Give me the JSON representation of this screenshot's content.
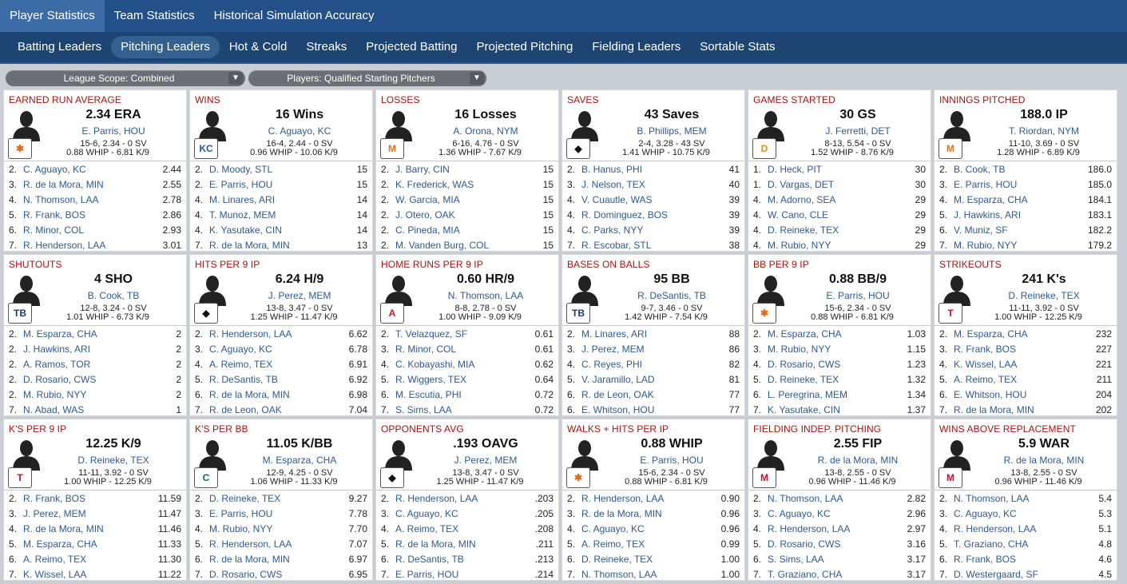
{
  "top_tabs": [
    {
      "label": "Player Statistics",
      "active": true
    },
    {
      "label": "Team Statistics",
      "active": false
    },
    {
      "label": "Historical Simulation Accuracy",
      "active": false
    }
  ],
  "sub_tabs": [
    {
      "label": "Batting Leaders",
      "active": false
    },
    {
      "label": "Pitching Leaders",
      "active": true
    },
    {
      "label": "Hot & Cold",
      "active": false
    },
    {
      "label": "Streaks",
      "active": false
    },
    {
      "label": "Projected Batting",
      "active": false
    },
    {
      "label": "Projected Pitching",
      "active": false
    },
    {
      "label": "Fielding Leaders",
      "active": false
    },
    {
      "label": "Sortable Stats",
      "active": false
    }
  ],
  "filters": {
    "league_scope": "League Scope: Combined",
    "players": "Players: Qualified Starting Pitchers"
  },
  "cards": [
    {
      "title": "EARNED RUN AVERAGE",
      "logo": "HOU",
      "leader": {
        "value": "2.34 ERA",
        "name": "E. Parris, HOU",
        "line1": "15-6, 2.34 - 0 SV",
        "line2": "0.88 WHIP - 6.81 K/9"
      },
      "rows": [
        {
          "rank": "2.",
          "name": "C. Aguayo, KC",
          "value": "2.44"
        },
        {
          "rank": "3.",
          "name": "R. de la Mora, MIN",
          "value": "2.55"
        },
        {
          "rank": "4.",
          "name": "N. Thomson, LAA",
          "value": "2.78"
        },
        {
          "rank": "5.",
          "name": "R. Frank, BOS",
          "value": "2.86"
        },
        {
          "rank": "6.",
          "name": "R. Minor, COL",
          "value": "2.93"
        },
        {
          "rank": "7.",
          "name": "R. Henderson, LAA",
          "value": "3.01"
        }
      ]
    },
    {
      "title": "WINS",
      "logo": "KC",
      "leader": {
        "value": "16 Wins",
        "name": "C. Aguayo, KC",
        "line1": "16-4, 2.44 - 0 SV",
        "line2": "0.96 WHIP - 10.06 K/9"
      },
      "rows": [
        {
          "rank": "2.",
          "name": "D. Moody, STL",
          "value": "15"
        },
        {
          "rank": "2.",
          "name": "E. Parris, HOU",
          "value": "15"
        },
        {
          "rank": "4.",
          "name": "M. Linares, ARI",
          "value": "14"
        },
        {
          "rank": "4.",
          "name": "T. Munoz, MEM",
          "value": "14"
        },
        {
          "rank": "4.",
          "name": "K. Yasutake, CIN",
          "value": "14"
        },
        {
          "rank": "7.",
          "name": "R. de la Mora, MIN",
          "value": "13"
        }
      ]
    },
    {
      "title": "LOSSES",
      "logo": "NYM",
      "leader": {
        "value": "16 Losses",
        "name": "A. Orona, NYM",
        "line1": "6-16, 4.76 - 0 SV",
        "line2": "1.36 WHIP - 7.67 K/9"
      },
      "rows": [
        {
          "rank": "2.",
          "name": "J. Barry, CIN",
          "value": "15"
        },
        {
          "rank": "2.",
          "name": "K. Frederick, WAS",
          "value": "15"
        },
        {
          "rank": "2.",
          "name": "W. Garcia, MIA",
          "value": "15"
        },
        {
          "rank": "2.",
          "name": "J. Otero, OAK",
          "value": "15"
        },
        {
          "rank": "2.",
          "name": "C. Pineda, MIA",
          "value": "15"
        },
        {
          "rank": "2.",
          "name": "M. Vanden Burg, COL",
          "value": "15"
        }
      ]
    },
    {
      "title": "SAVES",
      "logo": "MEM",
      "leader": {
        "value": "43 Saves",
        "name": "B. Phillips, MEM",
        "line1": "2-4, 3.28 - 43 SV",
        "line2": "1.41 WHIP - 10.75 K/9"
      },
      "rows": [
        {
          "rank": "2.",
          "name": "B. Hanus, PHI",
          "value": "41"
        },
        {
          "rank": "3.",
          "name": "J. Nelson, TEX",
          "value": "40"
        },
        {
          "rank": "4.",
          "name": "V. Cuautle, WAS",
          "value": "39"
        },
        {
          "rank": "4.",
          "name": "R. Dominguez, BOS",
          "value": "39"
        },
        {
          "rank": "4.",
          "name": "C. Parks, NYY",
          "value": "39"
        },
        {
          "rank": "7.",
          "name": "R. Escobar, STL",
          "value": "38"
        }
      ]
    },
    {
      "title": "GAMES STARTED",
      "logo": "DET",
      "leader": {
        "value": "30 GS",
        "name": "J. Ferretti, DET",
        "line1": "8-13, 5.54 - 0 SV",
        "line2": "1.52 WHIP - 8.76 K/9"
      },
      "rows": [
        {
          "rank": "1.",
          "name": "D. Heck, PIT",
          "value": "30"
        },
        {
          "rank": "1.",
          "name": "D. Vargas, DET",
          "value": "30"
        },
        {
          "rank": "4.",
          "name": "M. Adorno, SEA",
          "value": "29"
        },
        {
          "rank": "4.",
          "name": "W. Cano, CLE",
          "value": "29"
        },
        {
          "rank": "4.",
          "name": "D. Reineke, TEX",
          "value": "29"
        },
        {
          "rank": "4.",
          "name": "M. Rubio, NYY",
          "value": "29"
        }
      ]
    },
    {
      "title": "INNINGS PITCHED",
      "logo": "NYM",
      "leader": {
        "value": "188.0 IP",
        "name": "T. Riordan, NYM",
        "line1": "11-10, 3.69 - 0 SV",
        "line2": "1.28 WHIP - 6.89 K/9"
      },
      "rows": [
        {
          "rank": "2.",
          "name": "B. Cook, TB",
          "value": "186.0"
        },
        {
          "rank": "3.",
          "name": "E. Parris, HOU",
          "value": "185.0"
        },
        {
          "rank": "4.",
          "name": "M. Esparza, CHA",
          "value": "184.1"
        },
        {
          "rank": "5.",
          "name": "J. Hawkins, ARI",
          "value": "183.1"
        },
        {
          "rank": "6.",
          "name": "V. Muniz, SF",
          "value": "182.2"
        },
        {
          "rank": "7.",
          "name": "M. Rubio, NYY",
          "value": "179.2"
        }
      ]
    },
    {
      "title": "SHUTOUTS",
      "logo": "TB",
      "leader": {
        "value": "4 SHO",
        "name": "B. Cook, TB",
        "line1": "12-8, 3.24 - 0 SV",
        "line2": "1.01 WHIP - 6.73 K/9"
      },
      "rows": [
        {
          "rank": "2.",
          "name": "M. Esparza, CHA",
          "value": "2"
        },
        {
          "rank": "2.",
          "name": "J. Hawkins, ARI",
          "value": "2"
        },
        {
          "rank": "2.",
          "name": "A. Ramos, TOR",
          "value": "2"
        },
        {
          "rank": "2.",
          "name": "D. Rosario, CWS",
          "value": "2"
        },
        {
          "rank": "2.",
          "name": "M. Rubio, NYY",
          "value": "2"
        },
        {
          "rank": "7.",
          "name": "N. Abad, WAS",
          "value": "1"
        }
      ]
    },
    {
      "title": "HITS PER 9 IP",
      "logo": "MEM",
      "leader": {
        "value": "6.24 H/9",
        "name": "J. Perez, MEM",
        "line1": "13-8, 3.47 - 0 SV",
        "line2": "1.25 WHIP - 11.47 K/9"
      },
      "rows": [
        {
          "rank": "2.",
          "name": "R. Henderson, LAA",
          "value": "6.62"
        },
        {
          "rank": "3.",
          "name": "C. Aguayo, KC",
          "value": "6.78"
        },
        {
          "rank": "4.",
          "name": "A. Reimo, TEX",
          "value": "6.91"
        },
        {
          "rank": "5.",
          "name": "R. DeSantis, TB",
          "value": "6.92"
        },
        {
          "rank": "6.",
          "name": "R. de la Mora, MIN",
          "value": "6.98"
        },
        {
          "rank": "7.",
          "name": "R. de Leon, OAK",
          "value": "7.04"
        }
      ]
    },
    {
      "title": "HOME RUNS PER 9 IP",
      "logo": "LAA",
      "leader": {
        "value": "0.60 HR/9",
        "name": "N. Thomson, LAA",
        "line1": "8-8, 2.78 - 0 SV",
        "line2": "1.00 WHIP - 9.09 K/9"
      },
      "rows": [
        {
          "rank": "2.",
          "name": "T. Velazquez, SF",
          "value": "0.61"
        },
        {
          "rank": "3.",
          "name": "R. Minor, COL",
          "value": "0.61"
        },
        {
          "rank": "4.",
          "name": "C. Kobayashi, MIA",
          "value": "0.62"
        },
        {
          "rank": "5.",
          "name": "R. Wiggers, TEX",
          "value": "0.64"
        },
        {
          "rank": "6.",
          "name": "M. Escutia, PHI",
          "value": "0.72"
        },
        {
          "rank": "7.",
          "name": "S. Sims, LAA",
          "value": "0.72"
        }
      ]
    },
    {
      "title": "BASES ON BALLS",
      "logo": "TB",
      "leader": {
        "value": "95 BB",
        "name": "R. DeSantis, TB",
        "line1": "9-7, 3.46 - 0 SV",
        "line2": "1.42 WHIP - 7.54 K/9"
      },
      "rows": [
        {
          "rank": "2.",
          "name": "M. Linares, ARI",
          "value": "88"
        },
        {
          "rank": "3.",
          "name": "J. Perez, MEM",
          "value": "86"
        },
        {
          "rank": "4.",
          "name": "C. Reyes, PHI",
          "value": "82"
        },
        {
          "rank": "5.",
          "name": "V. Jaramillo, LAD",
          "value": "81"
        },
        {
          "rank": "6.",
          "name": "R. de Leon, OAK",
          "value": "77"
        },
        {
          "rank": "6.",
          "name": "E. Whitson, HOU",
          "value": "77"
        }
      ]
    },
    {
      "title": "BB PER 9 IP",
      "logo": "HOU",
      "leader": {
        "value": "0.88 BB/9",
        "name": "E. Parris, HOU",
        "line1": "15-6, 2.34 - 0 SV",
        "line2": "0.88 WHIP - 6.81 K/9"
      },
      "rows": [
        {
          "rank": "2.",
          "name": "M. Esparza, CHA",
          "value": "1.03"
        },
        {
          "rank": "3.",
          "name": "M. Rubio, NYY",
          "value": "1.15"
        },
        {
          "rank": "4.",
          "name": "D. Rosario, CWS",
          "value": "1.23"
        },
        {
          "rank": "5.",
          "name": "D. Reineke, TEX",
          "value": "1.32"
        },
        {
          "rank": "6.",
          "name": "L. Peregrina, MEM",
          "value": "1.34"
        },
        {
          "rank": "7.",
          "name": "K. Yasutake, CIN",
          "value": "1.37"
        }
      ]
    },
    {
      "title": "STRIKEOUTS",
      "logo": "TEX",
      "leader": {
        "value": "241 K's",
        "name": "D. Reineke, TEX",
        "line1": "11-11, 3.92 - 0 SV",
        "line2": "1.00 WHIP - 12.25 K/9"
      },
      "rows": [
        {
          "rank": "2.",
          "name": "M. Esparza, CHA",
          "value": "232"
        },
        {
          "rank": "3.",
          "name": "R. Frank, BOS",
          "value": "227"
        },
        {
          "rank": "4.",
          "name": "K. Wissel, LAA",
          "value": "221"
        },
        {
          "rank": "5.",
          "name": "A. Reimo, TEX",
          "value": "211"
        },
        {
          "rank": "6.",
          "name": "E. Whitson, HOU",
          "value": "204"
        },
        {
          "rank": "7.",
          "name": "R. de la Mora, MIN",
          "value": "202"
        }
      ]
    },
    {
      "title": "K'S PER 9 IP",
      "logo": "TEX",
      "leader": {
        "value": "12.25 K/9",
        "name": "D. Reineke, TEX",
        "line1": "11-11, 3.92 - 0 SV",
        "line2": "1.00 WHIP - 12.25 K/9"
      },
      "rows": [
        {
          "rank": "2.",
          "name": "R. Frank, BOS",
          "value": "11.59"
        },
        {
          "rank": "3.",
          "name": "J. Perez, MEM",
          "value": "11.47"
        },
        {
          "rank": "4.",
          "name": "R. de la Mora, MIN",
          "value": "11.46"
        },
        {
          "rank": "5.",
          "name": "M. Esparza, CHA",
          "value": "11.33"
        },
        {
          "rank": "6.",
          "name": "A. Reimo, TEX",
          "value": "11.30"
        },
        {
          "rank": "7.",
          "name": "K. Wissel, LAA",
          "value": "11.22"
        }
      ]
    },
    {
      "title": "K'S PER BB",
      "logo": "CHA",
      "leader": {
        "value": "11.05 K/BB",
        "name": "M. Esparza, CHA",
        "line1": "12-9, 4.25 - 0 SV",
        "line2": "1.06 WHIP - 11.33 K/9"
      },
      "rows": [
        {
          "rank": "2.",
          "name": "D. Reineke, TEX",
          "value": "9.27"
        },
        {
          "rank": "3.",
          "name": "E. Parris, HOU",
          "value": "7.78"
        },
        {
          "rank": "4.",
          "name": "M. Rubio, NYY",
          "value": "7.70"
        },
        {
          "rank": "5.",
          "name": "R. Henderson, LAA",
          "value": "7.07"
        },
        {
          "rank": "6.",
          "name": "R. de la Mora, MIN",
          "value": "6.97"
        },
        {
          "rank": "7.",
          "name": "D. Rosario, CWS",
          "value": "6.95"
        }
      ]
    },
    {
      "title": "OPPONENTS AVG",
      "logo": "MEM",
      "leader": {
        "value": ".193 OAVG",
        "name": "J. Perez, MEM",
        "line1": "13-8, 3.47 - 0 SV",
        "line2": "1.25 WHIP - 11.47 K/9"
      },
      "rows": [
        {
          "rank": "2.",
          "name": "R. Henderson, LAA",
          "value": ".203"
        },
        {
          "rank": "3.",
          "name": "C. Aguayo, KC",
          "value": ".205"
        },
        {
          "rank": "4.",
          "name": "A. Reimo, TEX",
          "value": ".208"
        },
        {
          "rank": "5.",
          "name": "R. de la Mora, MIN",
          "value": ".211"
        },
        {
          "rank": "6.",
          "name": "R. DeSantis, TB",
          "value": ".213"
        },
        {
          "rank": "7.",
          "name": "E. Parris, HOU",
          "value": ".214"
        }
      ]
    },
    {
      "title": "WALKS + HITS PER IP",
      "logo": "HOU",
      "leader": {
        "value": "0.88 WHIP",
        "name": "E. Parris, HOU",
        "line1": "15-6, 2.34 - 0 SV",
        "line2": "0.88 WHIP - 6.81 K/9"
      },
      "rows": [
        {
          "rank": "2.",
          "name": "R. Henderson, LAA",
          "value": "0.90"
        },
        {
          "rank": "3.",
          "name": "R. de la Mora, MIN",
          "value": "0.96"
        },
        {
          "rank": "4.",
          "name": "C. Aguayo, KC",
          "value": "0.96"
        },
        {
          "rank": "5.",
          "name": "A. Reimo, TEX",
          "value": "0.99"
        },
        {
          "rank": "6.",
          "name": "D. Reineke, TEX",
          "value": "1.00"
        },
        {
          "rank": "7.",
          "name": "N. Thomson, LAA",
          "value": "1.00"
        }
      ]
    },
    {
      "title": "FIELDING INDEP. PITCHING",
      "logo": "MIN",
      "leader": {
        "value": "2.55 FIP",
        "name": "R. de la Mora, MIN",
        "line1": "13-8, 2.55 - 0 SV",
        "line2": "0.96 WHIP - 11.46 K/9"
      },
      "rows": [
        {
          "rank": "2.",
          "name": "N. Thomson, LAA",
          "value": "2.82"
        },
        {
          "rank": "3.",
          "name": "C. Aguayo, KC",
          "value": "2.96"
        },
        {
          "rank": "4.",
          "name": "R. Henderson, LAA",
          "value": "2.97"
        },
        {
          "rank": "5.",
          "name": "D. Rosario, CWS",
          "value": "3.16"
        },
        {
          "rank": "6.",
          "name": "S. Sims, LAA",
          "value": "3.17"
        },
        {
          "rank": "7.",
          "name": "T. Graziano, CHA",
          "value": "3.17"
        }
      ]
    },
    {
      "title": "WINS ABOVE REPLACEMENT",
      "logo": "MIN",
      "leader": {
        "value": "5.9 WAR",
        "name": "R. de la Mora, MIN",
        "line1": "13-8, 2.55 - 0 SV",
        "line2": "0.96 WHIP - 11.46 K/9"
      },
      "rows": [
        {
          "rank": "2.",
          "name": "N. Thomson, LAA",
          "value": "5.4"
        },
        {
          "rank": "3.",
          "name": "C. Aguayo, KC",
          "value": "5.3"
        },
        {
          "rank": "4.",
          "name": "R. Henderson, LAA",
          "value": "5.1"
        },
        {
          "rank": "5.",
          "name": "T. Graziano, CHA",
          "value": "4.8"
        },
        {
          "rank": "6.",
          "name": "R. Frank, BOS",
          "value": "4.6"
        },
        {
          "rank": "7.",
          "name": "D. Westergaard, SF",
          "value": "4.5"
        }
      ]
    }
  ]
}
